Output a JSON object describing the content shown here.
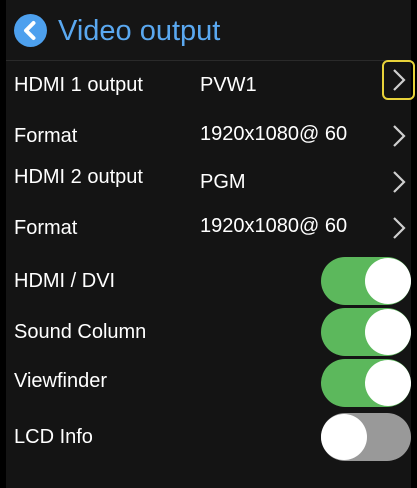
{
  "header": {
    "title": "Video output",
    "back_icon": "chevron-left-circle-icon"
  },
  "rows": [
    {
      "label": "HDMI 1 output",
      "value": "PVW1"
    },
    {
      "label": "Format",
      "value": "1920x1080@ 60"
    },
    {
      "label": "HDMI 2 output",
      "value": "PGM"
    },
    {
      "label": "Format",
      "value": "1920x1080@ 60"
    }
  ],
  "toggles": [
    {
      "label": "HDMI / DVI",
      "state": "on"
    },
    {
      "label": "Sound Column",
      "state": "on"
    },
    {
      "label": "Viewfinder",
      "state": "on"
    },
    {
      "label": "LCD Info",
      "state": "off"
    }
  ],
  "colors": {
    "accent": "#5aa8f0",
    "toggle_on": "#5cb85c",
    "toggle_off": "#999999",
    "focus_highlight": "#e8d23a"
  }
}
